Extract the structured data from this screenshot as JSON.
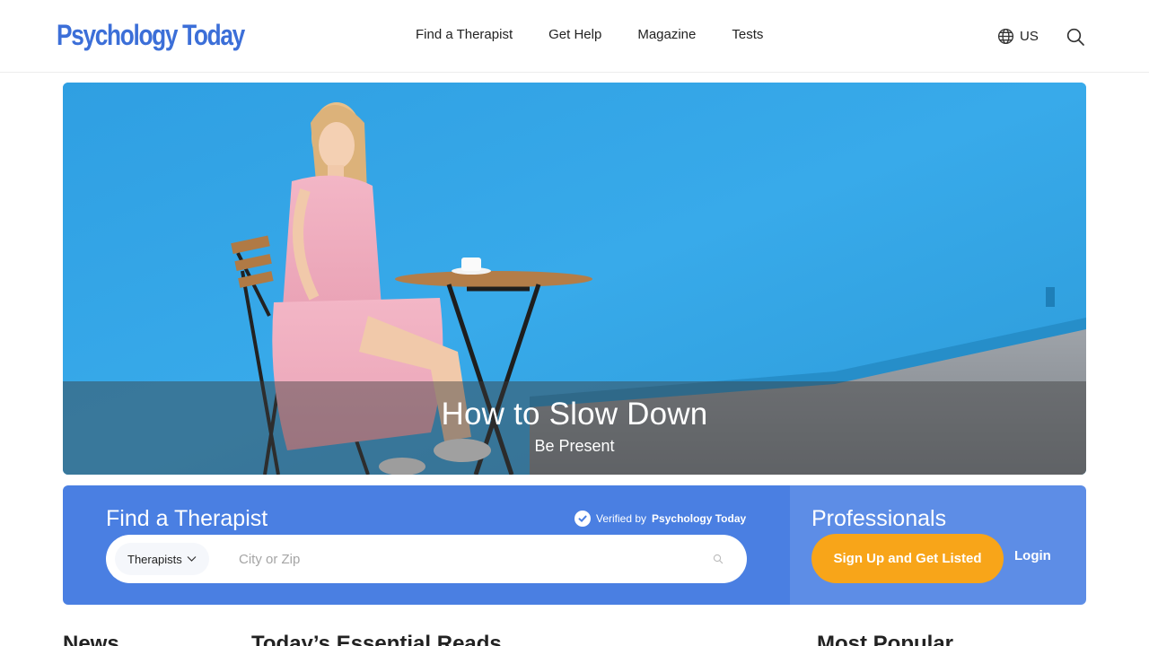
{
  "header": {
    "logo": "Psychology Today",
    "nav": [
      "Find a Therapist",
      "Get Help",
      "Magazine",
      "Tests"
    ],
    "region_label": "US",
    "icons": {
      "globe": "globe-icon",
      "search": "search-icon"
    }
  },
  "hero": {
    "title": "How to Slow Down",
    "subtitle": "Be Present"
  },
  "finder": {
    "title": "Find a Therapist",
    "verified_prefix": "Verified by",
    "verified_brand": "Psychology Today",
    "type_label": "Therapists",
    "city_placeholder": "City or Zip"
  },
  "professionals": {
    "title": "Professionals",
    "signup_label": "Sign Up and Get Listed",
    "login_label": "Login"
  },
  "sections": [
    "News",
    "Today’s Essential Reads",
    "Most Popular"
  ],
  "colors": {
    "brand": "#3c6fd8",
    "finder_bg": "#4a7fe2",
    "pros_bg": "#5d8de6",
    "cta": "#f8a519"
  }
}
